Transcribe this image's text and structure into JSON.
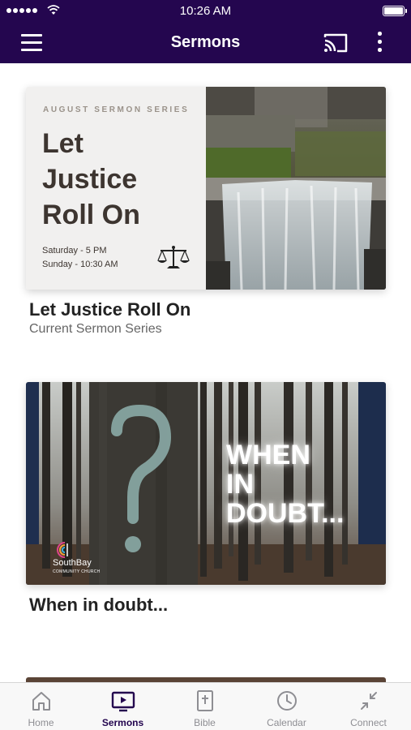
{
  "status_bar": {
    "time": "10:26 AM"
  },
  "nav": {
    "title": "Sermons",
    "menu_icon": "hamburger-menu-icon",
    "cast_icon": "cast-icon",
    "more_icon": "more-vertical-icon"
  },
  "colors": {
    "nav_background": "#24064f",
    "active_tab": "#24064f",
    "inactive_tab": "#8e8e93"
  },
  "sermons": [
    {
      "title": "Let Justice Roll On",
      "subtitle": "Current Sermon Series",
      "artwork": {
        "series_label": "AUGUST SERMON SERIES",
        "title_lines": [
          "Let",
          "Justice",
          "Roll On"
        ],
        "times": [
          "Saturday - 5 PM",
          "Sunday - 10:30 AM"
        ],
        "icon": "scales-of-justice-icon"
      }
    },
    {
      "title": "When in doubt...",
      "subtitle": "",
      "artwork": {
        "headline_lines": [
          "WHEN",
          "IN",
          "DOUBT..."
        ],
        "church_name": "SouthBay",
        "church_subname": "COMMUNITY CHURCH"
      }
    }
  ],
  "tabs": [
    {
      "label": "Home",
      "icon": "home-icon",
      "active": false
    },
    {
      "label": "Sermons",
      "icon": "tv-play-icon",
      "active": true
    },
    {
      "label": "Bible",
      "icon": "bible-icon",
      "active": false
    },
    {
      "label": "Calendar",
      "icon": "clock-icon",
      "active": false
    },
    {
      "label": "Connect",
      "icon": "connect-arrows-icon",
      "active": false
    }
  ]
}
